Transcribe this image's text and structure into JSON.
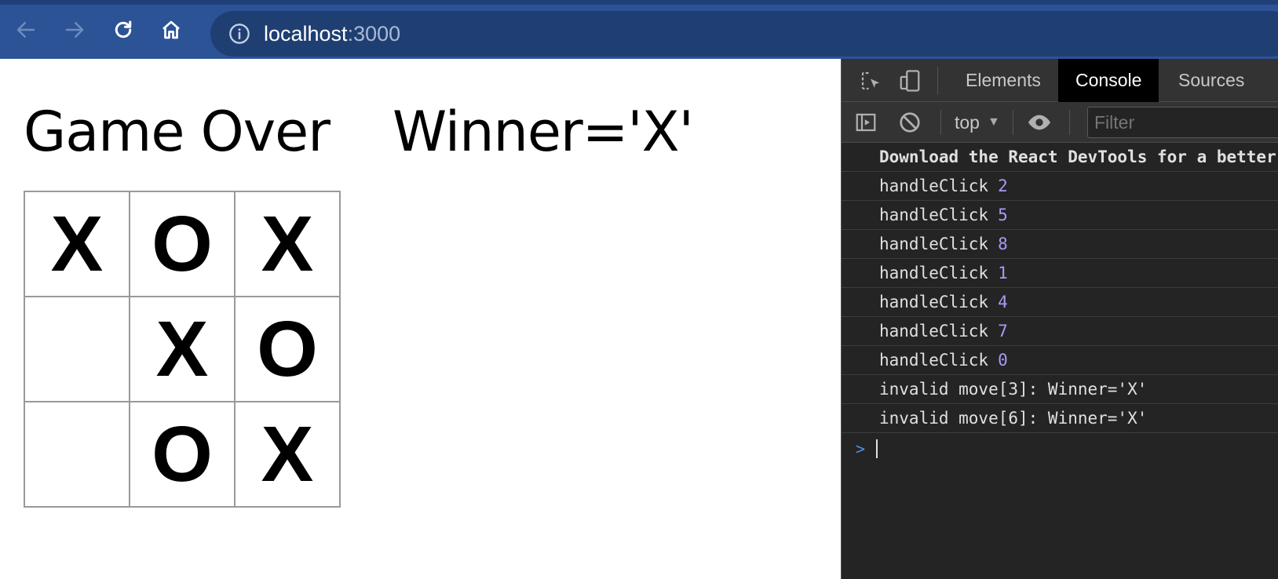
{
  "browser": {
    "url_host": "localhost",
    "url_port": ":3000",
    "icons": [
      "back-icon",
      "forward-icon",
      "reload-icon",
      "home-icon",
      "info-icon"
    ],
    "colors": {
      "toolbar": "#2c5396",
      "omnibox": "#1f3f73"
    }
  },
  "game": {
    "status": "Game Over",
    "winner": "Winner='X'",
    "board": [
      "X",
      "O",
      "X",
      "",
      "X",
      "O",
      "",
      "O",
      "X"
    ]
  },
  "devtools": {
    "tabs": [
      "Elements",
      "Console",
      "Sources"
    ],
    "active_tab": "Console",
    "context": "top",
    "filter_placeholder": "Filter",
    "messages": [
      {
        "text": "Download the React DevTools for a better",
        "num": "",
        "bold": true
      },
      {
        "text": "handleClick",
        "num": "2"
      },
      {
        "text": "handleClick",
        "num": "5"
      },
      {
        "text": "handleClick",
        "num": "8"
      },
      {
        "text": "handleClick",
        "num": "1"
      },
      {
        "text": "handleClick",
        "num": "4"
      },
      {
        "text": "handleClick",
        "num": "7"
      },
      {
        "text": "handleClick",
        "num": "0"
      },
      {
        "text": "invalid move[3]: Winner='X'",
        "num": ""
      },
      {
        "text": "invalid move[6]: Winner='X'",
        "num": ""
      }
    ],
    "prompt": ">",
    "colors": {
      "panel": "#242424",
      "number": "#a79bf6",
      "prompt": "#4f8fe6"
    }
  }
}
